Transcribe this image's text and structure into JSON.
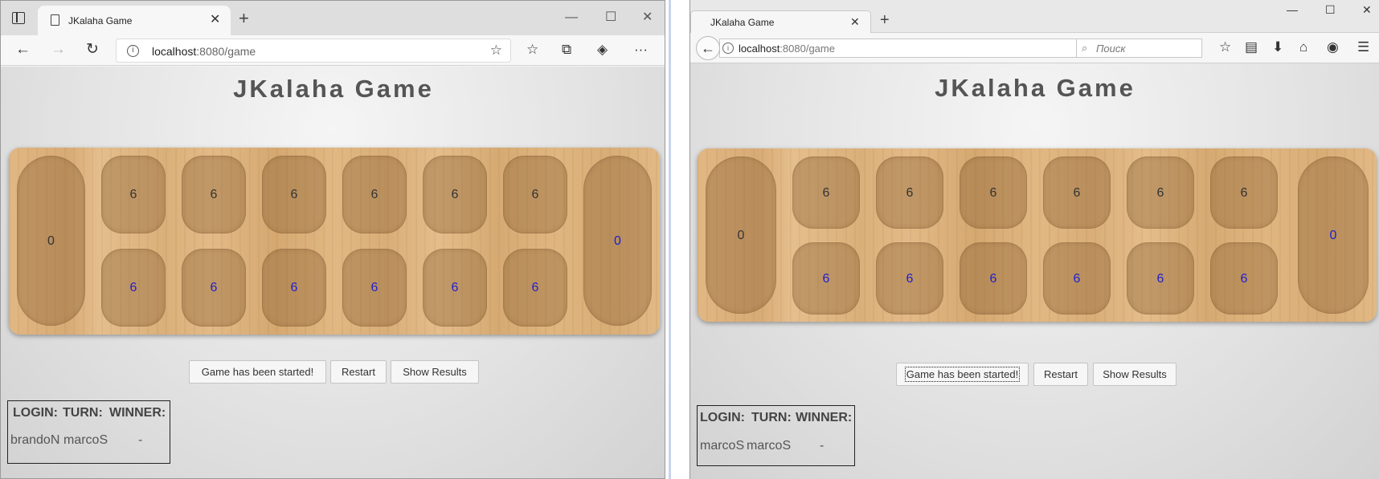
{
  "edge": {
    "tab_title": "JKalaha Game",
    "url_prefix": "localhost",
    "url_rest": ":8080/game",
    "game": {
      "title": "JKalaha Game",
      "top_pits": [
        6,
        6,
        6,
        6,
        6,
        6
      ],
      "bottom_pits": [
        6,
        6,
        6,
        6,
        6,
        6
      ],
      "left_store": 0,
      "right_store": 0,
      "buttons": {
        "status": "Game has been started!",
        "restart": "Restart",
        "results": "Show Results"
      },
      "info": {
        "login_h": "LOGIN:",
        "turn_h": "TURN:",
        "winner_h": "WINNER:",
        "login": "brandoN",
        "turn": "marcoS",
        "winner": "-"
      }
    }
  },
  "firefox": {
    "tab_title": "JKalaha Game",
    "url_prefix": "localhost",
    "url_rest": ":8080/game",
    "search_placeholder": "Поиск",
    "game": {
      "title": "JKalaha Game",
      "top_pits": [
        6,
        6,
        6,
        6,
        6,
        6
      ],
      "bottom_pits": [
        6,
        6,
        6,
        6,
        6,
        6
      ],
      "left_store": 0,
      "right_store": 0,
      "buttons": {
        "status": "Game has been started!",
        "restart": "Restart",
        "results": "Show Results"
      },
      "info": {
        "login_h": "LOGIN:",
        "turn_h": "TURN:",
        "winner_h": "WINNER:",
        "login": "marcoS",
        "turn": "marcoS",
        "winner": "-"
      }
    }
  },
  "icons": [
    "tab-actions-icon",
    "page-icon",
    "close-icon",
    "new-tab-icon",
    "minimize-icon",
    "maximize-icon",
    "back-icon",
    "forward-icon",
    "reload-icon",
    "info-icon",
    "favorite-add-icon",
    "favorites-icon",
    "collections-icon",
    "extension-icon",
    "more-icon",
    "search-icon",
    "star-icon",
    "reading-list-icon",
    "download-icon",
    "home-icon",
    "pocket-icon",
    "menu-icon"
  ]
}
